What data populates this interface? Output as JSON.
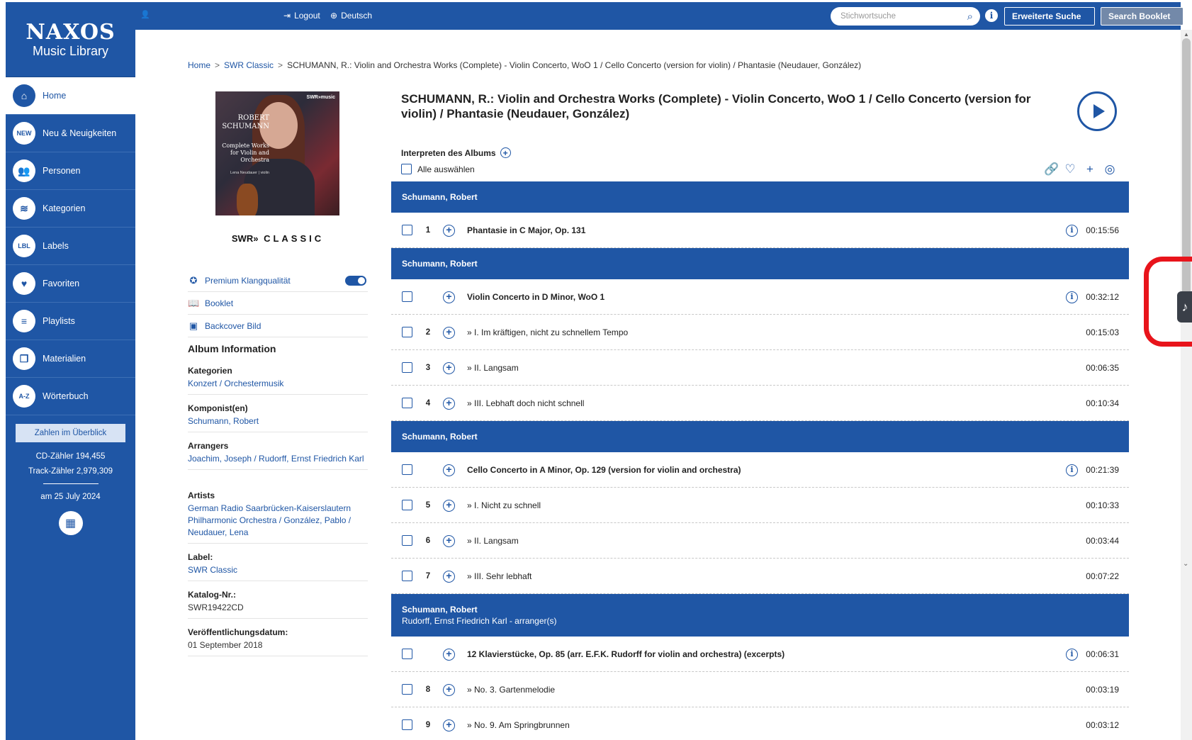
{
  "logo": {
    "line1": "NAXOS",
    "line2": "Music Library"
  },
  "sidebar": {
    "items": [
      {
        "label": "Home",
        "icon": "home-icon",
        "glyph": "⌂"
      },
      {
        "label": "Neu & Neuigkeiten",
        "icon": "new-badge-icon",
        "glyph": "NEW"
      },
      {
        "label": "Personen",
        "icon": "people-icon",
        "glyph": "👥"
      },
      {
        "label": "Kategorien",
        "icon": "layers-icon",
        "glyph": "≋"
      },
      {
        "label": "Labels",
        "icon": "labels-icon",
        "glyph": "LBL"
      },
      {
        "label": "Favoriten",
        "icon": "heart-icon",
        "glyph": "♥"
      },
      {
        "label": "Playlists",
        "icon": "playlist-icon",
        "glyph": "≡"
      },
      {
        "label": "Materialien",
        "icon": "materials-icon",
        "glyph": "❐"
      },
      {
        "label": "Wörterbuch",
        "icon": "dictionary-icon",
        "glyph": "A-Z"
      }
    ],
    "stats_button": "Zahlen im Überblick",
    "cd_count": "CD-Zähler 194,455",
    "track_count": "Track-Zähler 2,979,309",
    "date": "am 25 July 2024"
  },
  "topbar": {
    "logout": "Logout",
    "language": "Deutsch",
    "search_placeholder": "Stichwortsuche",
    "advanced_search": "Erweiterte Suche",
    "search_booklet": "Search Booklet"
  },
  "breadcrumb": {
    "home": "Home",
    "label": "SWR Classic",
    "current": "SCHUMANN, R.: Violin and Orchestra Works (Complete) - Violin Concerto, WoO 1 / Cello Concerto (version for violin) / Phantasie (Neudauer, González)"
  },
  "cover": {
    "brand": "SWR»music",
    "composer": "ROBERT SCHUMANN",
    "work": "Complete Works for Violin and Orchestra",
    "performer": "Lena Neudauer | violin"
  },
  "label_logo": {
    "prefix": "SWR»",
    "name": "CLASSIC"
  },
  "options": {
    "premium": "Premium Klangqualität",
    "booklet": "Booklet",
    "backcover": "Backcover Bild"
  },
  "album_info": {
    "title": "Album Information",
    "kategorien_h": "Kategorien",
    "kategorien_v": "Konzert / Orchestermusik",
    "komponist_h": "Komponist(en)",
    "komponist_v": "Schumann, Robert",
    "arrangers_h": "Arrangers",
    "arrangers_v": "Joachim, Joseph / Rudorff, Ernst Friedrich Karl",
    "artists_h": "Artists",
    "artists_v": "German Radio Saarbrücken-Kaiserslautern Philharmonic Orchestra / González, Pablo / Neudauer, Lena",
    "label_h": "Label:",
    "label_v": "SWR Classic",
    "katalog_h": "Katalog-Nr.:",
    "katalog_v": "SWR19422CD",
    "datum_h": "Veröffentlichungsdatum:",
    "datum_v": "01 September 2018"
  },
  "main": {
    "title": "SCHUMANN, R.: Violin and Orchestra Works (Complete) - Violin Concerto, WoO 1 / Cello Concerto (version for violin) / Phantasie (Neudauer, González)",
    "interpreten": "Interpreten des Albums",
    "select_all": "Alle auswählen"
  },
  "tracklist": [
    {
      "type": "group",
      "name": "Schumann, Robert",
      "arranger": ""
    },
    {
      "type": "work",
      "num": "1",
      "title": "Phantasie in C Major, Op. 131",
      "duration": "00:15:56",
      "info": true
    },
    {
      "type": "group",
      "name": "Schumann, Robert",
      "arranger": ""
    },
    {
      "type": "work",
      "num": "",
      "title": "Violin Concerto in D Minor, WoO 1",
      "duration": "00:32:12",
      "info": true
    },
    {
      "type": "track",
      "num": "2",
      "title": "» I. Im kräftigen, nicht zu schnellem Tempo",
      "duration": "00:15:03"
    },
    {
      "type": "track",
      "num": "3",
      "title": "» II. Langsam",
      "duration": "00:06:35"
    },
    {
      "type": "track",
      "num": "4",
      "title": "» III. Lebhaft doch nicht schnell",
      "duration": "00:10:34"
    },
    {
      "type": "group",
      "name": "Schumann, Robert",
      "arranger": ""
    },
    {
      "type": "work",
      "num": "",
      "title": "Cello Concerto in A Minor, Op. 129 (version for violin and orchestra)",
      "duration": "00:21:39",
      "info": true
    },
    {
      "type": "track",
      "num": "5",
      "title": "» I. Nicht zu schnell",
      "duration": "00:10:33"
    },
    {
      "type": "track",
      "num": "6",
      "title": "» II. Langsam",
      "duration": "00:03:44"
    },
    {
      "type": "track",
      "num": "7",
      "title": "» III. Sehr lebhaft",
      "duration": "00:07:22"
    },
    {
      "type": "group",
      "name": "Schumann, Robert",
      "arranger": "Rudorff, Ernst Friedrich Karl - arranger(s)"
    },
    {
      "type": "work",
      "num": "",
      "title": "12 Klavierstücke, Op. 85 (arr. E.F.K. Rudorff for violin and orchestra) (excerpts)",
      "duration": "00:06:31",
      "info": true
    },
    {
      "type": "track",
      "num": "8",
      "title": "» No. 3. Gartenmelodie",
      "duration": "00:03:19"
    },
    {
      "type": "track",
      "num": "9",
      "title": "» No. 9. Am Springbrunnen",
      "duration": "00:03:12"
    }
  ],
  "colors": {
    "brand": "#1f56a5",
    "highlight": "#e8141b"
  }
}
